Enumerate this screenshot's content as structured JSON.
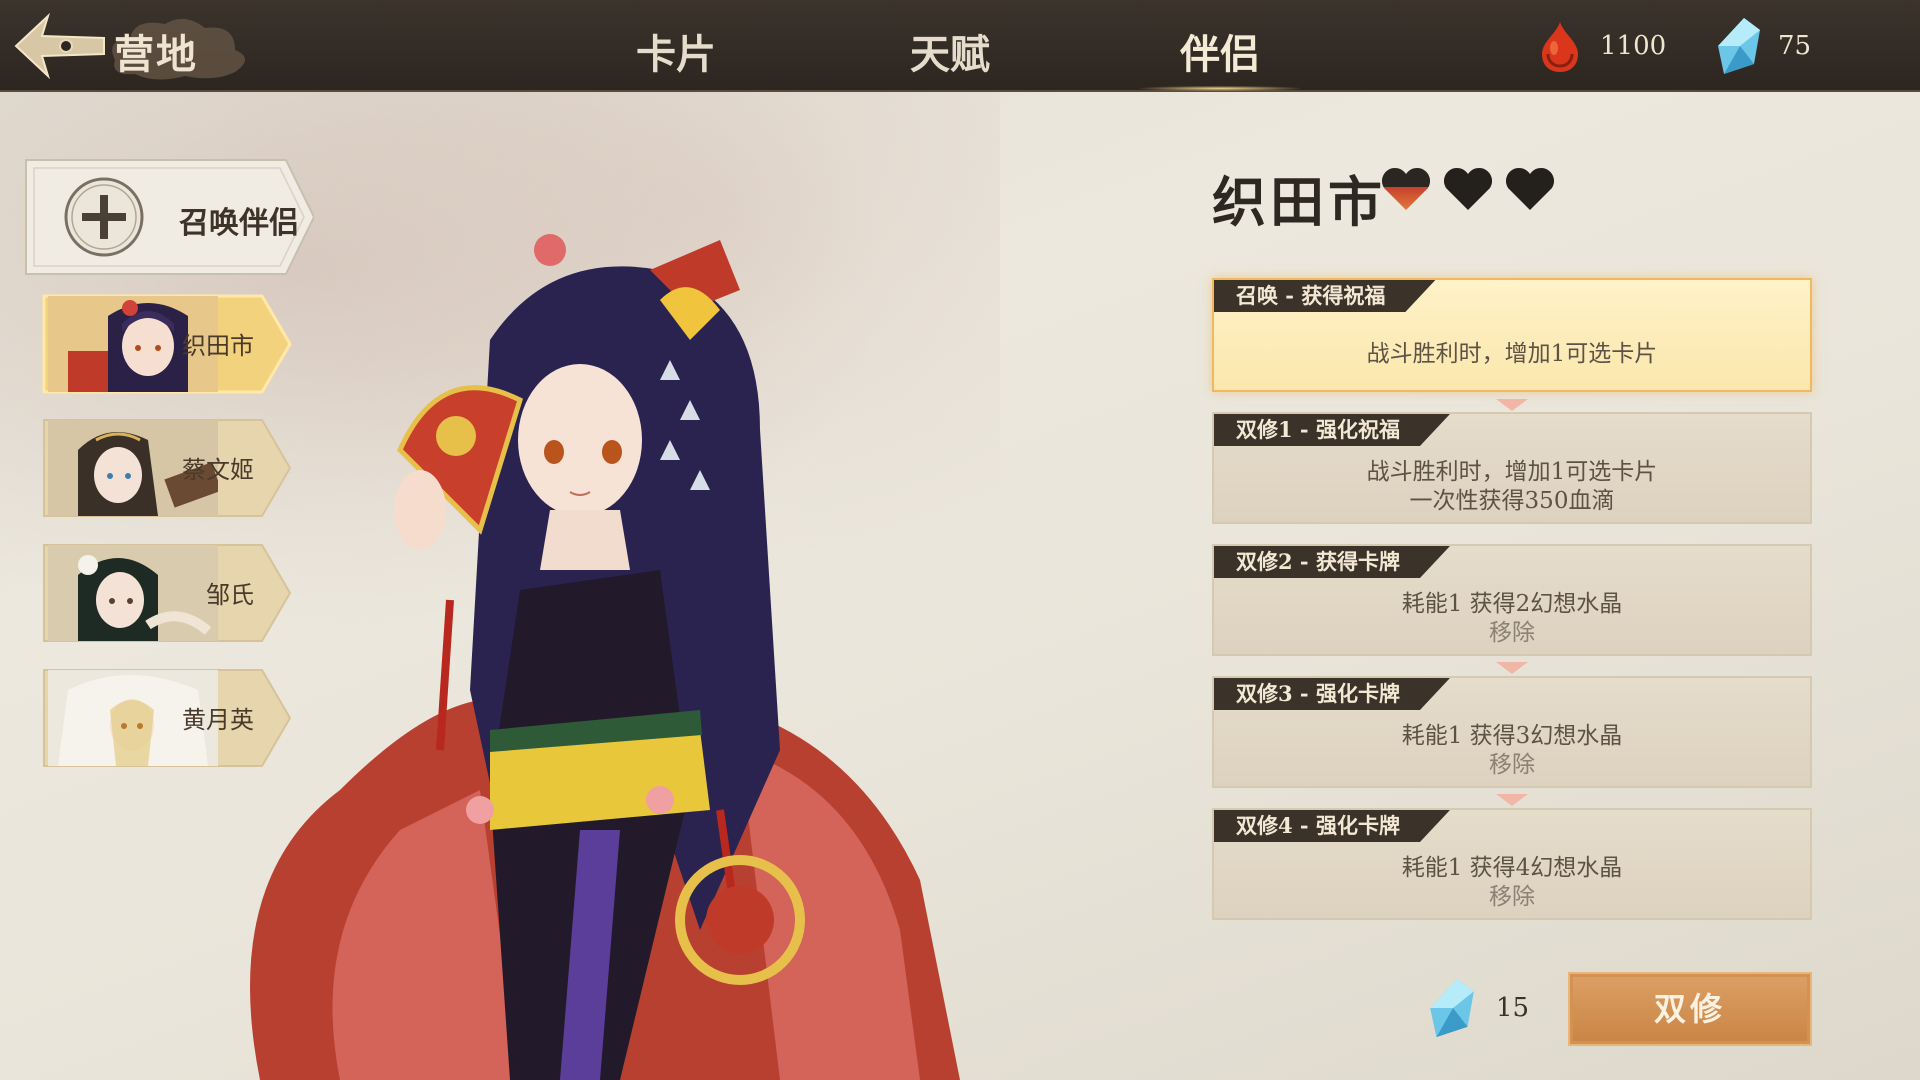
{
  "header": {
    "camp_title": "营地",
    "tabs": [
      {
        "label": "卡片",
        "active": false
      },
      {
        "label": "天赋",
        "active": false
      },
      {
        "label": "伴侣",
        "active": true
      }
    ],
    "resources": [
      {
        "icon": "blood-drop-icon",
        "value": "1100"
      },
      {
        "icon": "crystal-icon",
        "value": "75"
      }
    ]
  },
  "sidebar": {
    "summon_label": "召唤伴侣",
    "companions": [
      {
        "name": "织田市",
        "selected": true
      },
      {
        "name": "蔡文姬",
        "selected": false
      },
      {
        "name": "邹氏",
        "selected": false
      },
      {
        "name": "黄月英",
        "selected": false
      }
    ]
  },
  "detail": {
    "name": "织田市",
    "hearts": {
      "total": 3,
      "filled": 1
    },
    "cards": [
      {
        "tag": "召唤 - 获得祝福",
        "line1": "战斗胜利时，增加1可选卡片",
        "line2": ""
      },
      {
        "tag": "双修1 - 强化祝福",
        "line1": "战斗胜利时，增加1可选卡片",
        "line2": "一次性获得350血滴"
      },
      {
        "tag": "双修2 - 获得卡牌",
        "line1": "耗能1 获得2幻想水晶",
        "line2": "移除"
      },
      {
        "tag": "双修3 - 强化卡牌",
        "line1": "耗能1 获得3幻想水晶",
        "line2": "移除"
      },
      {
        "tag": "双修4 - 强化卡牌",
        "line1": "耗能1 获得4幻想水晶",
        "line2": "移除"
      }
    ],
    "cost": "15",
    "action_label": "双修"
  },
  "colors": {
    "topbar": "#2d2620",
    "accent_gold": "#f0b860",
    "button_orange": "#c98444",
    "tag_dark": "#3b322a"
  }
}
